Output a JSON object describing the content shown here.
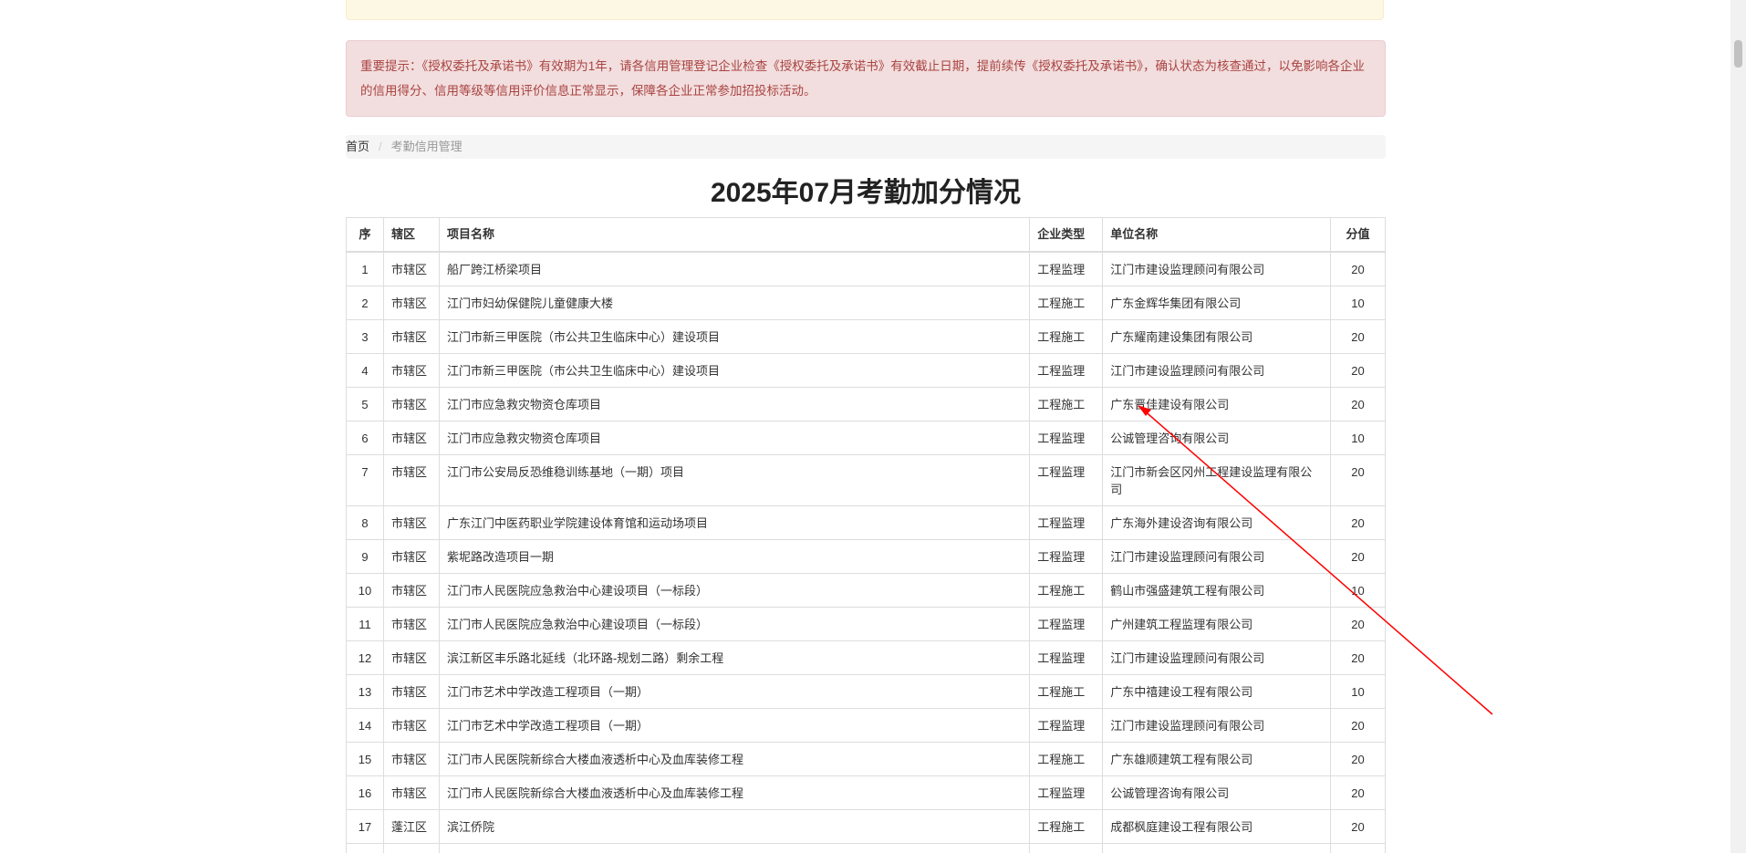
{
  "notices": {
    "warning_text": "",
    "important_text": "重要提示：《授权委托及承诺书》有效期为1年，请各信用管理登记企业检查《授权委托及承诺书》有效截止日期，提前续传《授权委托及承诺书》，确认状态为核查通过，以免影响各企业的信用得分、信用等级等信用评价信息正常显示，保障各企业正常参加招投标活动。"
  },
  "breadcrumb": {
    "home": "首页",
    "separator": "/",
    "current": "考勤信用管理"
  },
  "page_title": "2025年07月考勤加分情况",
  "table": {
    "headers": {
      "no": "序",
      "district": "辖区",
      "project": "项目名称",
      "type": "企业类型",
      "unit": "单位名称",
      "score": "分值"
    },
    "rows": [
      {
        "no": "1",
        "district": "市辖区",
        "project": "船厂跨江桥梁项目",
        "type": "工程监理",
        "unit": "江门市建设监理顾问有限公司",
        "score": "20"
      },
      {
        "no": "2",
        "district": "市辖区",
        "project": "江门市妇幼保健院儿童健康大楼",
        "type": "工程施工",
        "unit": "广东金辉华集团有限公司",
        "score": "10"
      },
      {
        "no": "3",
        "district": "市辖区",
        "project": "江门市新三甲医院（市公共卫生临床中心）建设项目",
        "type": "工程施工",
        "unit": "广东耀南建设集团有限公司",
        "score": "20"
      },
      {
        "no": "4",
        "district": "市辖区",
        "project": "江门市新三甲医院（市公共卫生临床中心）建设项目",
        "type": "工程监理",
        "unit": "江门市建设监理顾问有限公司",
        "score": "20"
      },
      {
        "no": "5",
        "district": "市辖区",
        "project": "江门市应急救灾物资仓库项目",
        "type": "工程施工",
        "unit": "广东晋佳建设有限公司",
        "score": "20"
      },
      {
        "no": "6",
        "district": "市辖区",
        "project": "江门市应急救灾物资仓库项目",
        "type": "工程监理",
        "unit": "公诚管理咨询有限公司",
        "score": "10"
      },
      {
        "no": "7",
        "district": "市辖区",
        "project": "江门市公安局反恐维稳训练基地（一期）项目",
        "type": "工程监理",
        "unit": "江门市新会区冈州工程建设监理有限公司",
        "score": "20"
      },
      {
        "no": "8",
        "district": "市辖区",
        "project": "广东江门中医药职业学院建设体育馆和运动场项目",
        "type": "工程监理",
        "unit": "广东海外建设咨询有限公司",
        "score": "20"
      },
      {
        "no": "9",
        "district": "市辖区",
        "project": "紫坭路改造项目一期",
        "type": "工程监理",
        "unit": "江门市建设监理顾问有限公司",
        "score": "20"
      },
      {
        "no": "10",
        "district": "市辖区",
        "project": "江门市人民医院应急救治中心建设项目（一标段）",
        "type": "工程施工",
        "unit": "鹤山市强盛建筑工程有限公司",
        "score": "10"
      },
      {
        "no": "11",
        "district": "市辖区",
        "project": "江门市人民医院应急救治中心建设项目（一标段）",
        "type": "工程监理",
        "unit": "广州建筑工程监理有限公司",
        "score": "20"
      },
      {
        "no": "12",
        "district": "市辖区",
        "project": "滨江新区丰乐路北延线（北环路-规划二路）剩余工程",
        "type": "工程监理",
        "unit": "江门市建设监理顾问有限公司",
        "score": "20"
      },
      {
        "no": "13",
        "district": "市辖区",
        "project": "江门市艺术中学改造工程项目（一期）",
        "type": "工程施工",
        "unit": "广东中禧建设工程有限公司",
        "score": "10"
      },
      {
        "no": "14",
        "district": "市辖区",
        "project": "江门市艺术中学改造工程项目（一期）",
        "type": "工程监理",
        "unit": "江门市建设监理顾问有限公司",
        "score": "20"
      },
      {
        "no": "15",
        "district": "市辖区",
        "project": "江门市人民医院新综合大楼血液透析中心及血库装修工程",
        "type": "工程施工",
        "unit": "广东雄顺建筑工程有限公司",
        "score": "20"
      },
      {
        "no": "16",
        "district": "市辖区",
        "project": "江门市人民医院新综合大楼血液透析中心及血库装修工程",
        "type": "工程监理",
        "unit": "公诚管理咨询有限公司",
        "score": "20"
      },
      {
        "no": "17",
        "district": "蓬江区",
        "project": "滨江侨院",
        "type": "工程施工",
        "unit": "成都枫庭建设工程有限公司",
        "score": "20"
      },
      {
        "no": "",
        "district": "",
        "project": "",
        "type": "",
        "unit": "",
        "score": ""
      }
    ]
  },
  "annotation": {
    "arrow_color": "#ff0000"
  }
}
